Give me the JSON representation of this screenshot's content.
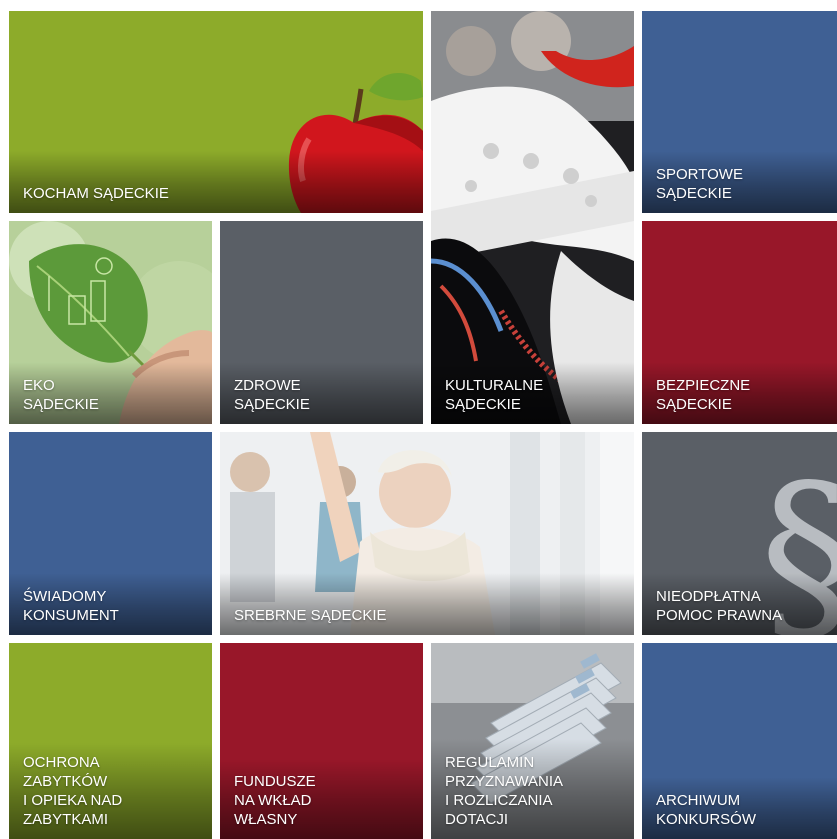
{
  "colors": {
    "green": "#8dab2a",
    "blue": "#3f6094",
    "red": "#981729",
    "gray": "#5a5f66"
  },
  "tiles": {
    "kocham": {
      "label": "KOCHAM SĄDECKIE",
      "icon": "apple-icon"
    },
    "kulturalne": {
      "label": "KULTURALNE\nSĄDECKIE",
      "icon": "folk-costume-photo"
    },
    "sportowe": {
      "label": "SPORTOWE\nSĄDECKIE"
    },
    "eko": {
      "label": "EKO\nSĄDECKIE",
      "icon": "leaf-photo"
    },
    "zdrowe": {
      "label": "ZDROWE\nSĄDECKIE"
    },
    "bezpieczne": {
      "label": "BEZPIECZNE\nSĄDECKIE"
    },
    "swiadomy": {
      "label": "ŚWIADOMY\nKONSUMENT"
    },
    "srebrne": {
      "label": "SREBRNE SĄDECKIE",
      "icon": "senior-exercise-photo"
    },
    "nieodplatna": {
      "label": "NIEODPŁATNA\nPOMOC PRAWNA",
      "icon": "paragraph-icon"
    },
    "ochrona": {
      "label": "OCHRONA\nZABYTKÓW\nI OPIEKA NAD\nZABYTKAMI"
    },
    "fundusze": {
      "label": "FUNDUSZE\nNA WKŁAD\nWŁASNY"
    },
    "regulamin": {
      "label": "REGULAMIN\nPRZYZNAWANIA\nI ROZLICZANIA\nDOTACJI",
      "icon": "folders-photo"
    },
    "archiwum": {
      "label": "ARCHIWUM\nKONKURSÓW"
    }
  }
}
